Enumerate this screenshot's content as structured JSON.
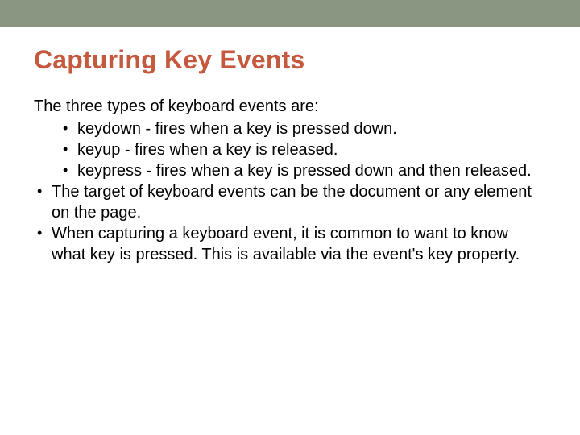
{
  "title": "Capturing Key Events",
  "lead": "The three types of keyboard events are:",
  "sub_items": [
    "keydown - fires when a key is pressed down.",
    "keyup - fires when a key is released.",
    "keypress - fires when a key is pressed down and then released."
  ],
  "main_items": [
    "The target of keyboard events can be the document or any element on the page.",
    "When capturing a keyboard event, it is common to want to know what key is pressed. This is available via the event's key property."
  ]
}
